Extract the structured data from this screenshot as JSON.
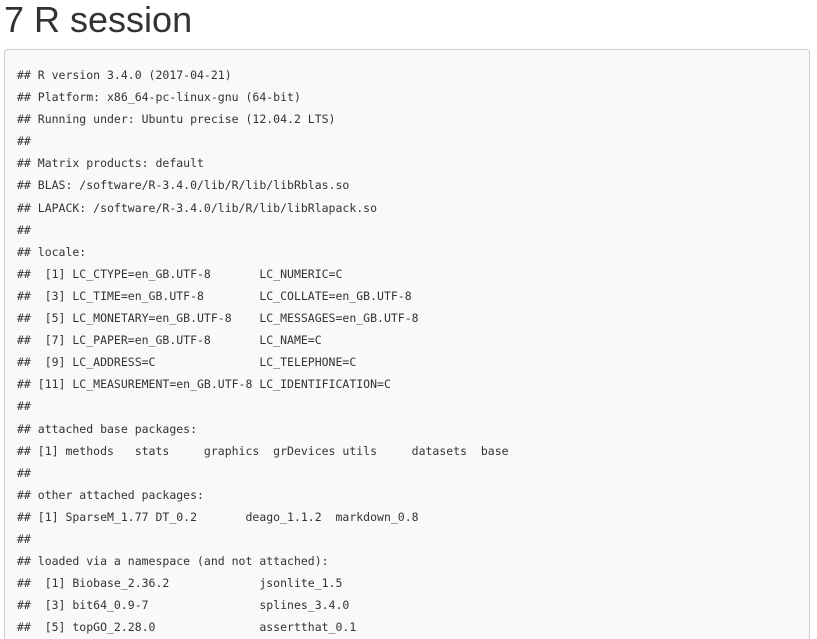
{
  "section": {
    "title": "7 R session"
  },
  "code": {
    "lines": [
      "## R version 3.4.0 (2017-04-21)",
      "## Platform: x86_64-pc-linux-gnu (64-bit)",
      "## Running under: Ubuntu precise (12.04.2 LTS)",
      "##",
      "## Matrix products: default",
      "## BLAS: /software/R-3.4.0/lib/R/lib/libRblas.so",
      "## LAPACK: /software/R-3.4.0/lib/R/lib/libRlapack.so",
      "##",
      "## locale:",
      "##  [1] LC_CTYPE=en_GB.UTF-8       LC_NUMERIC=C",
      "##  [3] LC_TIME=en_GB.UTF-8        LC_COLLATE=en_GB.UTF-8",
      "##  [5] LC_MONETARY=en_GB.UTF-8    LC_MESSAGES=en_GB.UTF-8",
      "##  [7] LC_PAPER=en_GB.UTF-8       LC_NAME=C",
      "##  [9] LC_ADDRESS=C               LC_TELEPHONE=C",
      "## [11] LC_MEASUREMENT=en_GB.UTF-8 LC_IDENTIFICATION=C",
      "##",
      "## attached base packages:",
      "## [1] methods   stats     graphics  grDevices utils     datasets  base",
      "##",
      "## other attached packages:",
      "## [1] SparseM_1.77 DT_0.2       deago_1.1.2  markdown_0.8",
      "##",
      "## loaded via a namespace (and not attached):",
      "##  [1] Biobase_2.36.2             jsonlite_1.5",
      "##  [3] bit64_0.9-7                splines_3.4.0",
      "##  [5] topGO_2.28.0               assertthat_0.1"
    ]
  }
}
